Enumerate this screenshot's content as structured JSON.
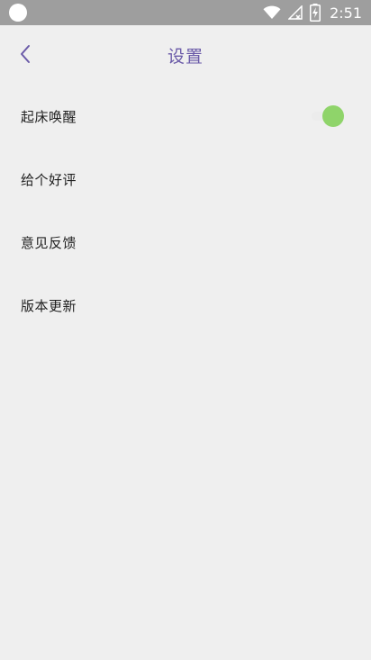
{
  "status_bar": {
    "time": "2:51",
    "icons": [
      "wifi-icon",
      "signal-icon",
      "battery-charging-icon"
    ]
  },
  "header": {
    "title": "设置",
    "back_icon": "chevron-left-icon"
  },
  "settings": {
    "items": [
      {
        "label": "起床唤醒",
        "toggle_on": true
      },
      {
        "label": "给个好评"
      },
      {
        "label": "意见反馈"
      },
      {
        "label": "版本更新"
      }
    ]
  },
  "colors": {
    "background": "#efefef",
    "status_bar": "#9e9e9e",
    "accent": "#6a5aa8",
    "toggle_on": "#8fd46a"
  }
}
